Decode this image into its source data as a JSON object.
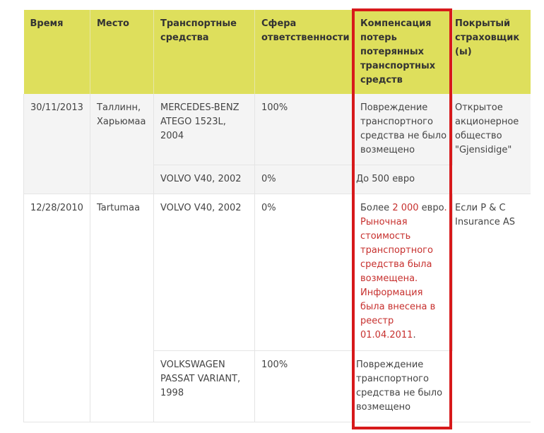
{
  "table": {
    "headers": [
      "Время",
      "Место",
      "Транспортные средства",
      "Сфера ответственности",
      "Компенсация потерь потерянных транспортных средств",
      "Покрытый страховщик (ы)"
    ],
    "rows": [
      {
        "date": "30/11/2013",
        "place": "Таллинн, Харьюмаа",
        "insurer": "Открытое акционерное общество \"Gjensidige\"",
        "vehicles": [
          {
            "vehicle": "MERCEDES-BENZ ATEGO 1523L, 2004",
            "liability": "100%",
            "compensation": "Повреждение транспортного средства не было возмещено"
          },
          {
            "vehicle": "VOLVO V40, 2002",
            "liability": "0%",
            "compensation": "До 500 евро"
          }
        ]
      },
      {
        "date": "12/28/2010",
        "place": "Tartumaa",
        "insurer": "Если P & C Insurance AS",
        "vehicles": [
          {
            "vehicle": "VOLVO V40, 2002",
            "liability": "0%",
            "compensation_parts": {
              "prefix": "Более ",
              "amount": "2 000",
              "middle": " евро",
              "highlight": ". Рыночная стоимость транспортного средства была возмещена. Информация была внесена в реестр 01.04.2011",
              "suffix": "."
            }
          },
          {
            "vehicle": "VOLKSWAGEN PASSAT VARIANT, 1998",
            "liability": "100%",
            "compensation": "Повреждение транспортного средства не было возмещено"
          }
        ]
      }
    ]
  },
  "colors": {
    "header_bg": "#dedf5c",
    "highlight_text": "#c7302e",
    "frame": "#d7191b"
  }
}
